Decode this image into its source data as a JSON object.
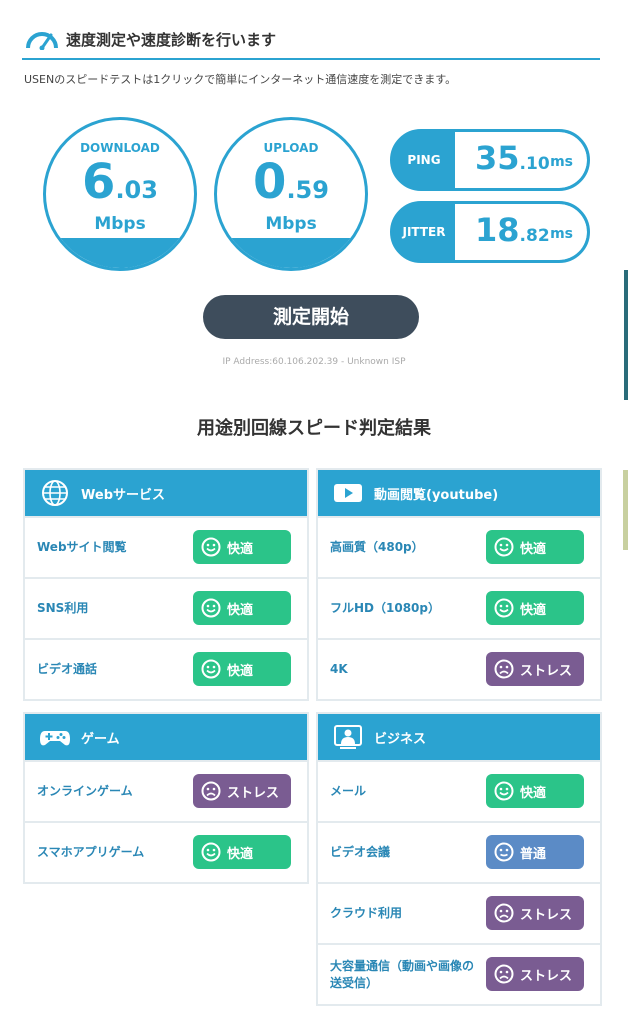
{
  "header": {
    "title": "速度測定や速度診断を行います"
  },
  "description": "USENのスピードテストは1クリックで簡単にインターネット通信速度を測定できます。",
  "download": {
    "label": "DOWNLOAD",
    "int": "6",
    "dec": ".03",
    "unit": "Mbps",
    "value": 6.03
  },
  "upload": {
    "label": "UPLOAD",
    "int": "0",
    "dec": ".59",
    "unit": "Mbps",
    "value": 0.59
  },
  "ping": {
    "label": "PING",
    "int": "35",
    "dec": ".10",
    "unit": "ms",
    "value": 35.1
  },
  "jitter": {
    "label": "JITTER",
    "int": "18",
    "dec": ".82",
    "unit": "ms",
    "value": 18.82
  },
  "start_button": "測定開始",
  "ip_line": "IP Address:60.106.202.39 - Unknown ISP",
  "section_title": "用途別回線スピード判定結果",
  "colors": {
    "accent": "#2ba3d1",
    "good": "#2bc489",
    "stress": "#7a5c92",
    "normal": "#5b8bc6",
    "button": "#3e4d5c"
  },
  "panels": {
    "web": {
      "title": "Webサービス",
      "icon": "globe-icon",
      "rows": [
        {
          "label": "Webサイト閲覧",
          "status": "快適"
        },
        {
          "label": "SNS利用",
          "status": "快適"
        },
        {
          "label": "ビデオ通話",
          "status": "快適"
        }
      ]
    },
    "video": {
      "title": "動画閲覧(youtube)",
      "icon": "play-icon",
      "rows": [
        {
          "label": "高画質（480p）",
          "status": "快適"
        },
        {
          "label": "フルHD（1080p）",
          "status": "快適"
        },
        {
          "label": "4K",
          "status": "ストレス"
        }
      ]
    },
    "game": {
      "title": "ゲーム",
      "icon": "gamepad-icon",
      "rows": [
        {
          "label": "オンラインゲーム",
          "status": "ストレス"
        },
        {
          "label": "スマホアプリゲーム",
          "status": "快適"
        }
      ]
    },
    "business": {
      "title": "ビジネス",
      "icon": "video-conference-icon",
      "rows": [
        {
          "label": "メール",
          "status": "快適"
        },
        {
          "label": "ビデオ会議",
          "status": "普通"
        },
        {
          "label": "クラウド利用",
          "status": "ストレス"
        },
        {
          "label": "大容量通信（動画や画像の送受信）",
          "status": "ストレス"
        }
      ]
    }
  }
}
